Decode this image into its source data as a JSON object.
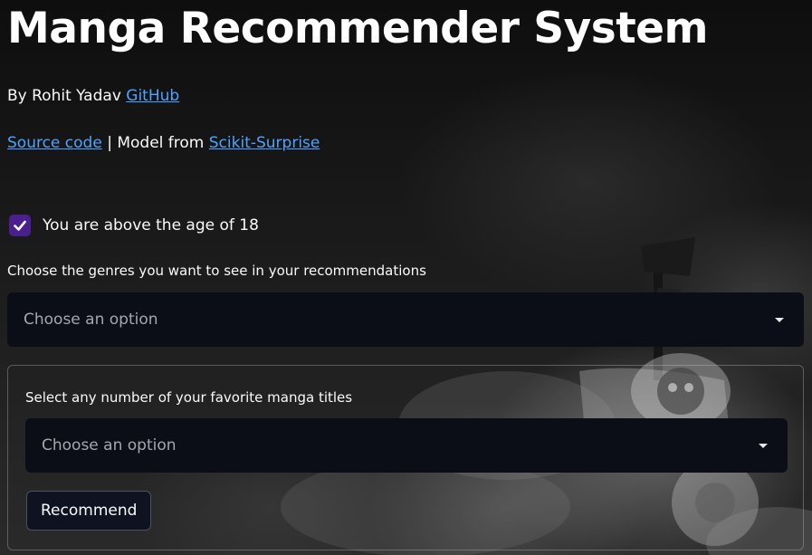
{
  "header": {
    "title": "Manga Recommender System",
    "byline_prefix": "By Rohit Yadav",
    "github_link": "GitHub",
    "source_link": "Source code",
    "separator": " | ",
    "model_prefix": "Model from ",
    "model_link": "Scikit-Surprise"
  },
  "age_check": {
    "label": "You are above the age of 18",
    "checked": true
  },
  "genres": {
    "label": "Choose the genres you want to see in your recommendations",
    "placeholder": "Choose an option"
  },
  "form": {
    "titles_label": "Select any number of your favorite manga titles",
    "titles_placeholder": "Choose an option",
    "submit_label": "Recommend"
  },
  "colors": {
    "link": "#4da3ff",
    "checkbox": "#4b1f8e",
    "input_bg": "#0b0e17"
  }
}
